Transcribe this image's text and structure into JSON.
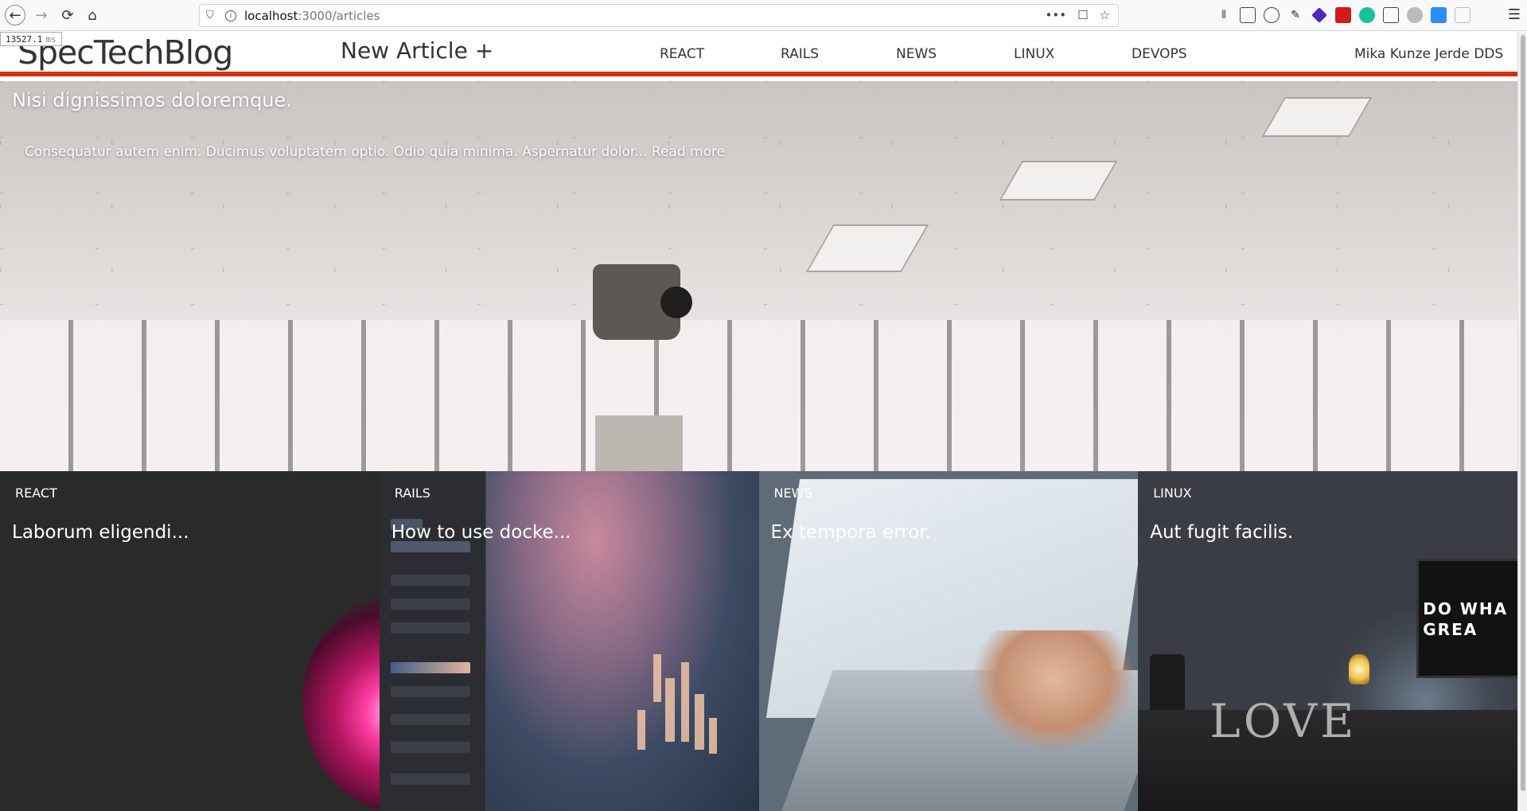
{
  "browser": {
    "url_host": "localhost",
    "url_path": ":3000/articles",
    "timer_value": "13527.1",
    "timer_unit": "ms",
    "url_actions": [
      "•••",
      "☐",
      "☆"
    ]
  },
  "header": {
    "brand": "SpecTechBlog",
    "new_article": "New Article +",
    "nav": [
      "REACT",
      "RAILS",
      "NEWS",
      "LINUX",
      "DEVOPS"
    ],
    "user": "Mika Kunze Jerde DDS",
    "accent_color": "#d32f0d"
  },
  "hero": {
    "title": "Nisi dignissimos doloremque.",
    "excerpt": "Consequatur autem enim. Ducimus voluptatem optio. Odio quia minima. Aspernatur dolor...",
    "read_more": "Read more"
  },
  "cards": [
    {
      "category": "REACT",
      "title": "Laborum eligendi..."
    },
    {
      "category": "RAILS",
      "title": "How to use docke..."
    },
    {
      "category": "NEWS",
      "title": "Ex tempora error."
    },
    {
      "category": "LINUX",
      "title": "Aut fugit facilis."
    }
  ],
  "linux_card": {
    "monitor_line1": "DO WHA",
    "monitor_line2": "GREA",
    "desk_text": "LOVE"
  }
}
